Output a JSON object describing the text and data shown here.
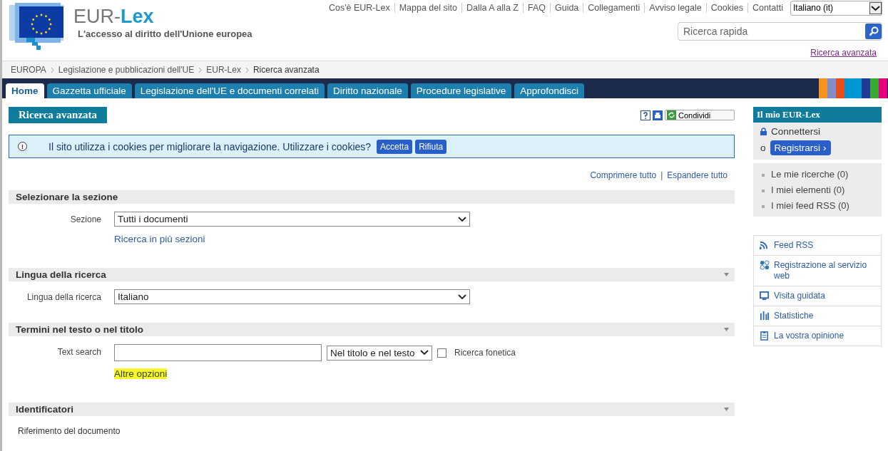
{
  "header": {
    "site_name": {
      "part_1": "EUR-",
      "part_2": "Lex"
    },
    "tagline": "L'accesso al diritto dell'Unione europea",
    "top_links": [
      "Cos'è EUR-Lex",
      "Mappa del sito",
      "Dalla A alla Z",
      "FAQ",
      "Guida",
      "Collegamenti",
      "Avviso legale",
      "Cookies",
      "Contatti"
    ],
    "language": "Italiano (it)",
    "search": {
      "placeholder": "Ricerca rapida"
    },
    "advanced_link": "Ricerca avanzata"
  },
  "breadcrumb": [
    "EUROPA",
    "Legislazione e pubblicazioni dell'UE",
    "EUR-Lex",
    "Ricerca avanzata"
  ],
  "tabs": [
    {
      "label": "Home",
      "selected": true
    },
    {
      "label": "Gazzetta ufficiale",
      "selected": false
    },
    {
      "label": "Legislazione dell'UE e documenti correlati",
      "selected": false
    },
    {
      "label": "Diritto nazionale",
      "selected": false
    },
    {
      "label": "Procedure legislative",
      "selected": false
    },
    {
      "label": "Approfondisci",
      "selected": false
    }
  ],
  "page_title": "Ricerca avanzata",
  "share_button": "Condividi",
  "cookie_banner": {
    "icon": "!",
    "message": "Il sito utilizza i cookies per migliorare la navigazione. Utilizzare i cookies?",
    "buttons": [
      "Accetta",
      "Rifiuta"
    ]
  },
  "collapse_links": [
    "Comprimere tutto",
    "Espandere tutto"
  ],
  "collapse_separator": "|",
  "sections": [
    {
      "title": "Selezionare la sezione",
      "toggle": false,
      "rows": [
        {
          "kind": "select",
          "label": "Sezione",
          "value": "Tutti i documenti",
          "link": {
            "text": "Ricerca in più sezioni",
            "highlighted": false
          }
        }
      ]
    },
    {
      "title": "Lingua della ricerca",
      "toggle": true,
      "rows": [
        {
          "kind": "select",
          "label": "Lingua della ricerca",
          "value": "Italiano"
        }
      ]
    },
    {
      "title": "Termini nel testo o nel titolo",
      "toggle": true,
      "rows": [
        {
          "kind": "text",
          "label": "Text search",
          "scope": "Nel titolo e nel testo",
          "checkbox": {
            "label": "Ricerca fonetica",
            "checked": false
          },
          "link": {
            "text": "Altre opzioni",
            "highlighted": true
          }
        }
      ]
    },
    {
      "title": "Identificatori",
      "toggle": true,
      "rows": [
        {
          "kind": "caption",
          "label": "Riferimento del documento"
        }
      ]
    }
  ],
  "sidebar": {
    "title": "Il mio EUR-Lex",
    "login": "Connettersi",
    "or": "o",
    "register": "Registrarsi",
    "register_arrow": "›",
    "items": [
      "Le mie ricerche (0)",
      "I miei elementi (0)",
      "I miei feed RSS (0)"
    ],
    "links": [
      "Feed RSS",
      "Registrazione al servizio web",
      "Visita guidata",
      "Statistiche",
      "La vostra opinione"
    ]
  }
}
